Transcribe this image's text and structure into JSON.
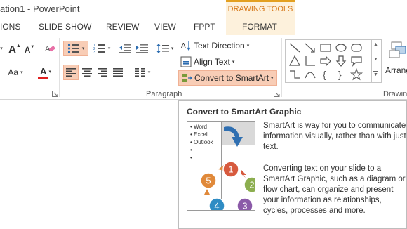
{
  "window": {
    "title": "ation1 - PowerPoint",
    "contextual_tab_group": "DRAWING TOOLS",
    "contextual_color": "#e3a021"
  },
  "tabs": [
    {
      "label": "IONS"
    },
    {
      "label": "SLIDE SHOW"
    },
    {
      "label": "REVIEW"
    },
    {
      "label": "VIEW"
    },
    {
      "label": "FPPT"
    },
    {
      "label": "FORMAT"
    }
  ],
  "ribbon": {
    "font_group": {
      "grow_font_icon": "A",
      "shrink_font_icon": "A",
      "clear_formatting_icon": "eraser-icon",
      "change_case_label": "Aa",
      "font_color_label": "A",
      "font_color": "#e02020"
    },
    "paragraph_group": {
      "label": "Paragraph",
      "text_direction": "Text Direction",
      "align_text": "Align Text",
      "convert_to_smartart": "Convert to SmartArt"
    },
    "drawing_group": {
      "label": "Drawin",
      "arrange_label": "Arrang"
    }
  },
  "tooltip": {
    "title": "Convert to SmartArt Graphic",
    "paragraph1": "SmartArt is way for you to communicate information visually, rather than with just text.",
    "paragraph2": "Converting text on your slide to a SmartArt Graphic, such as a diagram or flow chart, can organize and present your information as relationships, cycles, processes and more.",
    "preview": {
      "bullets": [
        "Word",
        "Excel",
        "Outlook",
        "",
        ""
      ],
      "cycle_numbers": [
        "1",
        "2",
        "3",
        "4",
        "5"
      ],
      "cycle_colors": [
        "#d75a3e",
        "#8cae4f",
        "#8b5aa8",
        "#2f8cc4",
        "#e0893a"
      ],
      "arrow_color": "#2f6fb1"
    }
  }
}
